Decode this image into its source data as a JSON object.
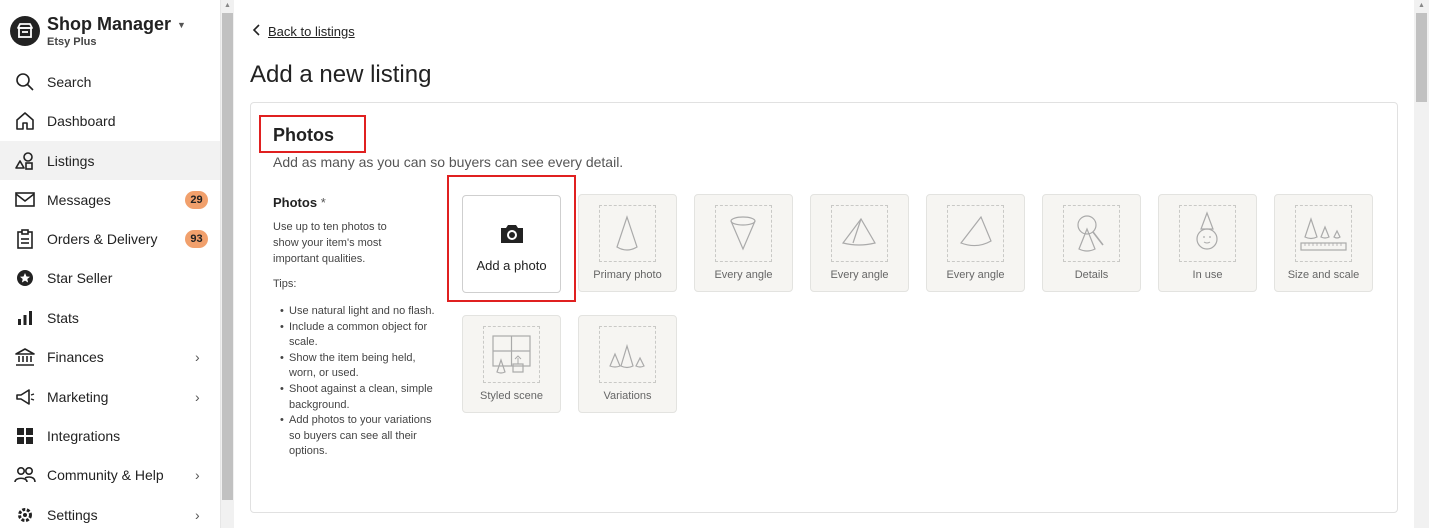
{
  "sidebar": {
    "brand_title": "Shop Manager",
    "brand_subtitle": "Etsy Plus",
    "items": [
      {
        "label": "Search",
        "icon": "search-icon"
      },
      {
        "label": "Dashboard",
        "icon": "home-icon"
      },
      {
        "label": "Listings",
        "icon": "listings-icon",
        "active": true
      },
      {
        "label": "Messages",
        "icon": "mail-icon",
        "badge": "29"
      },
      {
        "label": "Orders & Delivery",
        "icon": "clipboard-icon",
        "badge": "93"
      },
      {
        "label": "Star Seller",
        "icon": "star-seller-icon"
      },
      {
        "label": "Stats",
        "icon": "bar-chart-icon"
      },
      {
        "label": "Finances",
        "icon": "bank-icon",
        "chevron": true
      },
      {
        "label": "Marketing",
        "icon": "megaphone-icon",
        "chevron": true
      },
      {
        "label": "Integrations",
        "icon": "grid-icon"
      },
      {
        "label": "Community & Help",
        "icon": "people-icon",
        "chevron": true
      },
      {
        "label": "Settings",
        "icon": "gear-icon",
        "chevron": true
      }
    ]
  },
  "main": {
    "back_link": "Back to listings",
    "page_title": "Add a new listing",
    "section_title": "Photos",
    "section_desc": "Add as many as you can so buyers can see every detail.",
    "field_label": "Photos",
    "field_required": "*",
    "field_help": "Use up to ten photos to show your item's most important qualities.",
    "tips_label": "Tips:",
    "tips": [
      "Use natural light and no flash.",
      "Include a common object for scale.",
      "Show the item being held, worn, or used.",
      "Shoot against a clean, simple background.",
      "Add photos to your variations so buyers can see all their options."
    ],
    "add_photo_label": "Add a photo",
    "slots": [
      {
        "label": "Primary photo"
      },
      {
        "label": "Every angle"
      },
      {
        "label": "Every angle"
      },
      {
        "label": "Every angle"
      },
      {
        "label": "Details"
      },
      {
        "label": "In use"
      },
      {
        "label": "Size and scale"
      },
      {
        "label": "Styled scene"
      },
      {
        "label": "Variations"
      }
    ]
  },
  "colors": {
    "highlight": "#e02020",
    "badge": "#f1a06c",
    "slot_bg": "#f6f5f2"
  }
}
